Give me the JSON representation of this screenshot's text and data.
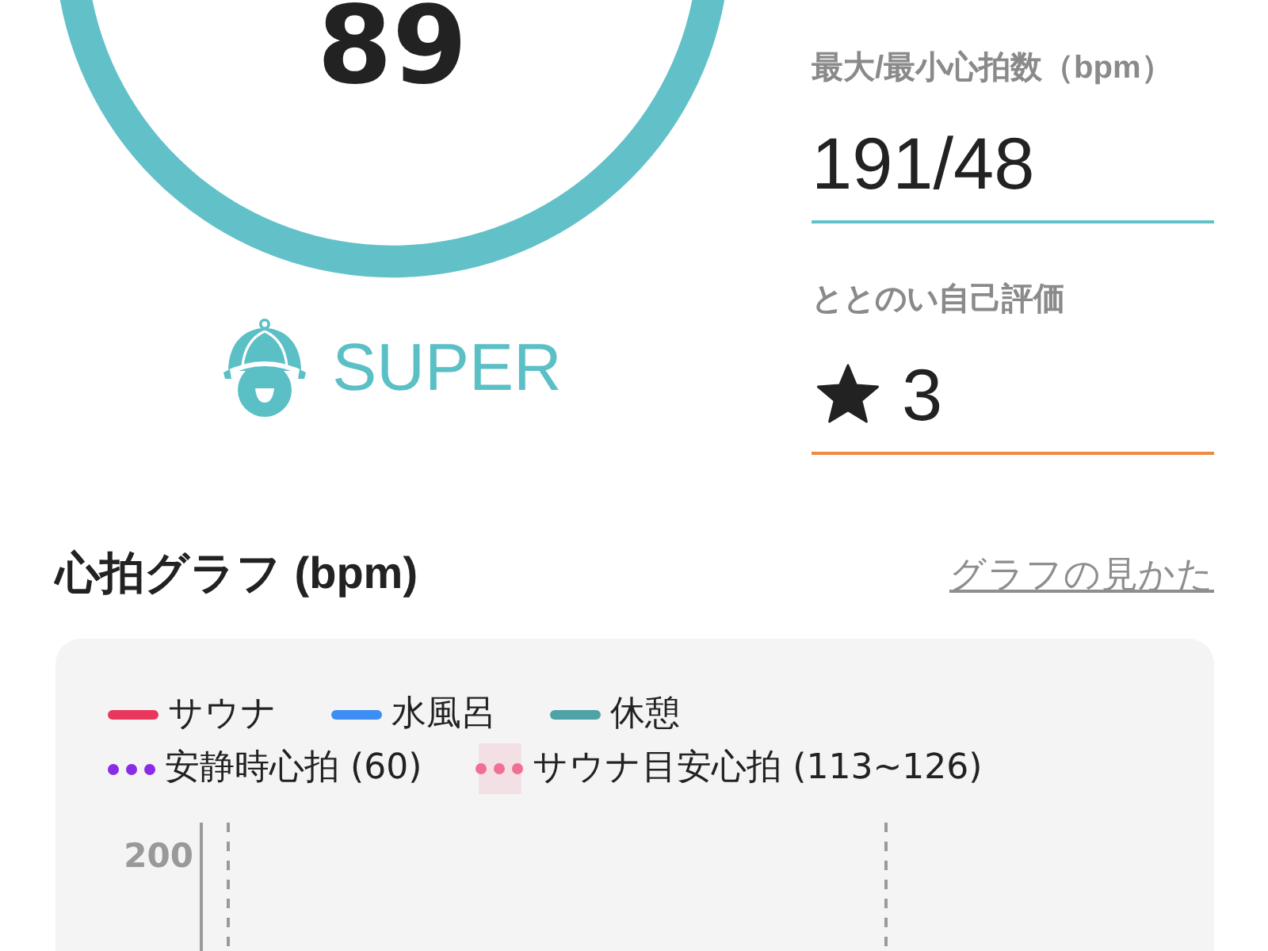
{
  "score": {
    "value": "89"
  },
  "rank": {
    "label": "SUPER"
  },
  "stats": [
    {
      "kind": "text",
      "label": "最大/最小心拍数（bpm）",
      "value": "191/48",
      "color": "#5ec3c8"
    },
    {
      "kind": "rating",
      "label": "ととのい自己評価",
      "value": "3",
      "color": "#ef8a43"
    }
  ],
  "heart_rate_graph": {
    "title": "心拍グラフ (bpm)",
    "help_link": "グラフの見かた",
    "legend_rows": [
      {
        "items": [
          {
            "kind": "line",
            "label": "サウナ",
            "color": "#e8365d"
          },
          {
            "kind": "line",
            "label": "水風呂",
            "color": "#3d8ef2"
          },
          {
            "kind": "line",
            "label": "休憩",
            "color": "#4fa3a6"
          }
        ]
      },
      {
        "items": [
          {
            "kind": "dots",
            "label": "安静時心拍 (60)",
            "color": "#8a2be8"
          },
          {
            "kind": "band",
            "label": "サウナ目安心拍 (113~126)",
            "color": "#f06f92"
          }
        ]
      }
    ],
    "y_ticks": [
      "200"
    ]
  }
}
